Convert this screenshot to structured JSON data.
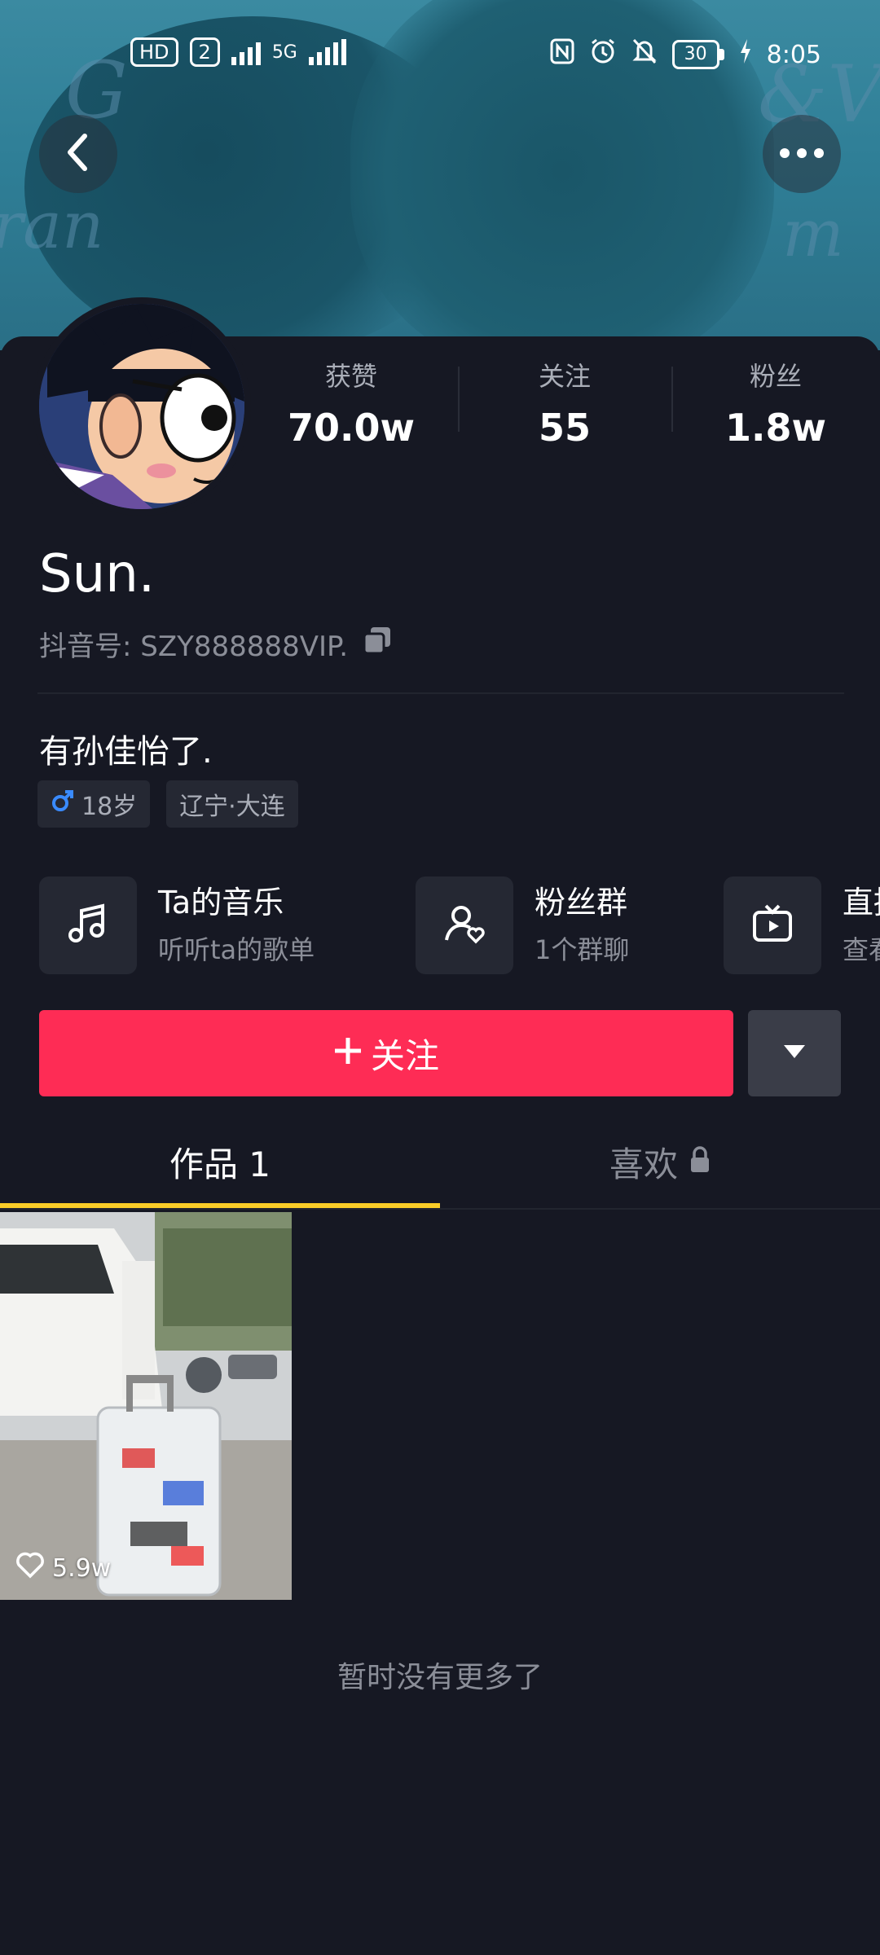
{
  "status_bar": {
    "hd": "HD",
    "sim": "2",
    "network": "5G",
    "battery": "30",
    "time": "8:05"
  },
  "header": {
    "back_icon": "chevron-left-icon",
    "more_icon": "more-horizontal-icon"
  },
  "stats": [
    {
      "label": "获赞",
      "value": "70.0w"
    },
    {
      "label": "关注",
      "value": "55"
    },
    {
      "label": "粉丝",
      "value": "1.8w"
    }
  ],
  "profile": {
    "name": "Sun.",
    "id_text": "抖音号: SZY888888VIP.",
    "bio": "有孙佳怡了.",
    "tags": [
      {
        "icon": "male-icon",
        "text": "18岁"
      },
      {
        "text": "辽宁·大连"
      }
    ]
  },
  "features": [
    {
      "icon": "music-note-icon",
      "title": "Ta的音乐",
      "subtitle": "听听ta的歌单"
    },
    {
      "icon": "fan-group-icon",
      "title": "粉丝群",
      "subtitle": "1个群聊"
    },
    {
      "icon": "tv-play-icon",
      "title": "直播",
      "subtitle": "查看"
    }
  ],
  "actions": {
    "follow_label": "关注",
    "accent": "#fe2c55"
  },
  "tabs": [
    {
      "label": "作品 1",
      "active": true
    },
    {
      "label": "喜欢",
      "locked": true
    }
  ],
  "videos": [
    {
      "likes": "5.9w"
    }
  ],
  "footer": {
    "no_more": "暂时没有更多了"
  }
}
